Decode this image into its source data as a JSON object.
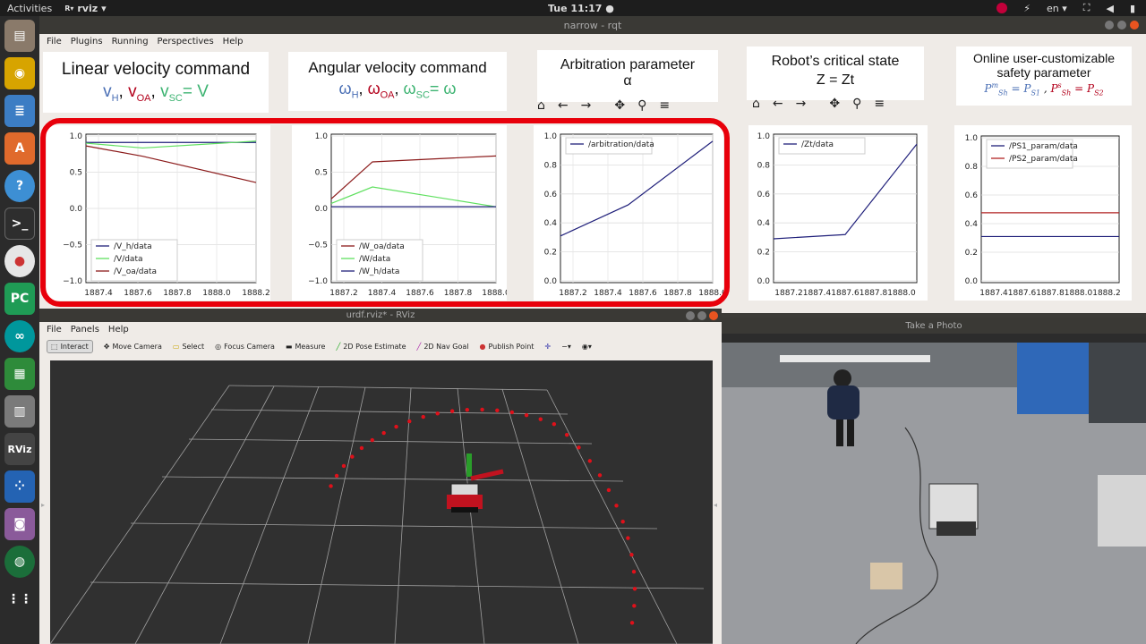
{
  "topbar": {
    "activities": "Activities",
    "app": "rviz",
    "clock": "Tue 11:17 ●",
    "lang": "en"
  },
  "dock": {
    "icons": [
      "files-icon",
      "music-icon",
      "text-editor-icon",
      "software-icon",
      "help-icon",
      "terminal-icon",
      "chrome-icon",
      "pycharm-icon",
      "arduino-icon",
      "calc-sheet-icon",
      "calculator-icon",
      "rviz-icon",
      "apps-grid-icon",
      "screenshot-icon",
      "globe-icon",
      "show-apps-icon"
    ]
  },
  "rqt": {
    "title": "narrow - rqt",
    "menu": [
      "File",
      "Plugins",
      "Running",
      "Perspectives",
      "Help"
    ]
  },
  "titles": {
    "linear": {
      "main": "Linear velocity command",
      "sub": "vH, vOA, vSC= V"
    },
    "angular": {
      "main": "Angular  velocity command",
      "sub": "ωH, ωOA, ωSC= ω"
    },
    "arbitration": {
      "main": "Arbitration  parameter",
      "sub": "α"
    },
    "critical": {
      "main": "Robot’s critical state",
      "sub": "Z = Zt"
    },
    "safety": {
      "main1": "Online user-customizable",
      "main2": "safety parameter",
      "sub": "P^m_Sh = P_S1 , P^s_Sh = P_S2"
    }
  },
  "chart_data": [
    {
      "type": "line",
      "x": [
        1887.3,
        1887.6,
        1888.2
      ],
      "series": [
        {
          "name": "/V_h/data",
          "color": "#1f1f7a",
          "values": [
            0.98,
            0.98,
            0.98
          ]
        },
        {
          "name": "/V/data",
          "color": "#5fe05f",
          "values": [
            0.97,
            0.9,
            1.0
          ]
        },
        {
          "name": "/V_oa/data",
          "color": "#8b1a1a",
          "values": [
            0.93,
            0.78,
            0.4
          ]
        }
      ],
      "xticks": [
        "1887.4",
        "1887.6",
        "1887.8",
        "1888.0",
        "1888.2"
      ],
      "yticks": [
        "1.0",
        "0.5",
        "0.0",
        "−0.5",
        "−1.0"
      ],
      "ylim": [
        -1.05,
        1.1
      ],
      "legend": "bottom-left"
    },
    {
      "type": "line",
      "x": [
        1887.2,
        1887.4,
        1888.0
      ],
      "series": [
        {
          "name": "/W_oa/data",
          "color": "#8b1a1a",
          "values": [
            0.12,
            0.68,
            0.77
          ]
        },
        {
          "name": "/W/data",
          "color": "#5fe05f",
          "values": [
            0.05,
            0.3,
            0.0
          ]
        },
        {
          "name": "/W_h/data",
          "color": "#1f1f7a",
          "values": [
            0.0,
            0.0,
            0.0
          ]
        }
      ],
      "xticks": [
        "1887.2",
        "1887.4",
        "1887.6",
        "1887.8",
        "1888.0"
      ],
      "yticks": [
        "1.0",
        "0.5",
        "0.0",
        "−0.5",
        "−1.0"
      ],
      "ylim": [
        -1.15,
        1.1
      ],
      "legend": "bottom-left"
    },
    {
      "type": "line",
      "x": [
        1887.1,
        1887.5,
        1888.0
      ],
      "series": [
        {
          "name": "/arbitration/data",
          "color": "#1f1f7a",
          "values": [
            0.33,
            0.55,
            1.0
          ]
        }
      ],
      "xticks": [
        "1887.2",
        "1887.4",
        "1887.6",
        "1887.8",
        "1888.0"
      ],
      "yticks": [
        "1.0",
        "0.8",
        "0.6",
        "0.4",
        "0.2",
        "0.0"
      ],
      "ylim": [
        0,
        1.05
      ],
      "legend": "top-left"
    },
    {
      "type": "line",
      "x": [
        1887.2,
        1887.6,
        1888.0
      ],
      "series": [
        {
          "name": "/Zt/data",
          "color": "#1f1f7a",
          "values": [
            0.31,
            0.34,
            0.98
          ]
        }
      ],
      "xticks": [
        "1887.2",
        "1887.4",
        "1887.6",
        "1887.8",
        "1888.0"
      ],
      "xtick_text": "1887.21887.41887.61887.81888.0",
      "yticks": [
        "1.0",
        "0.8",
        "0.6",
        "0.4",
        "0.2",
        "0.0"
      ],
      "ylim": [
        0,
        1.05
      ],
      "legend": "top-left"
    },
    {
      "type": "line",
      "x": [
        1887.4,
        1888.2
      ],
      "series": [
        {
          "name": "/PS1_param/data",
          "color": "#1f1f7a",
          "values": [
            0.33,
            0.33
          ]
        },
        {
          "name": "/PS2_param/data",
          "color": "#b22222",
          "values": [
            0.5,
            0.5
          ]
        }
      ],
      "xtick_text": "1887.41887.61887.81888.01888.2",
      "yticks": [
        "1.0",
        "0.8",
        "0.6",
        "0.4",
        "0.2",
        "0.0"
      ],
      "ylim": [
        0,
        1.05
      ],
      "legend": "top-left"
    }
  ],
  "rviz": {
    "title": "urdf.rviz* - RViz",
    "menu": [
      "File",
      "Panels",
      "Help"
    ],
    "tools": [
      "Interact",
      "Move Camera",
      "Select",
      "Focus Camera",
      "Measure",
      "2D Pose Estimate",
      "2D Nav Goal",
      "Publish Point"
    ]
  },
  "camera": {
    "title": "Take a Photo"
  },
  "colors": {
    "highlight": "#e8000b",
    "vh": "#4a6fb5",
    "voa": "#b3001b",
    "vsc": "#3cb371"
  }
}
